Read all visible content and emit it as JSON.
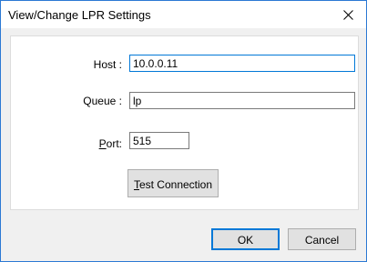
{
  "window": {
    "title": "View/Change LPR Settings",
    "close_glyph": "×"
  },
  "fields": {
    "host": {
      "label_prefix": "",
      "label_mnemonic": "",
      "label_rest": "Host :",
      "value": "10.0.0.11"
    },
    "queue": {
      "label_prefix": "",
      "label_mnemonic": "",
      "label_rest": "Queue :",
      "value": "lp"
    },
    "port": {
      "label_prefix": "",
      "label_mnemonic": "P",
      "label_rest": "ort:",
      "value": "515"
    }
  },
  "buttons": {
    "test_connection": {
      "mnemonic": "T",
      "rest": "est Connection"
    },
    "ok": {
      "label": "OK"
    },
    "cancel": {
      "label": "Cancel"
    }
  },
  "colors": {
    "accent": "#0078d7",
    "window_border": "#2b79d4",
    "button_face": "#e1e1e1"
  },
  "icons": {
    "close": "close-icon"
  }
}
